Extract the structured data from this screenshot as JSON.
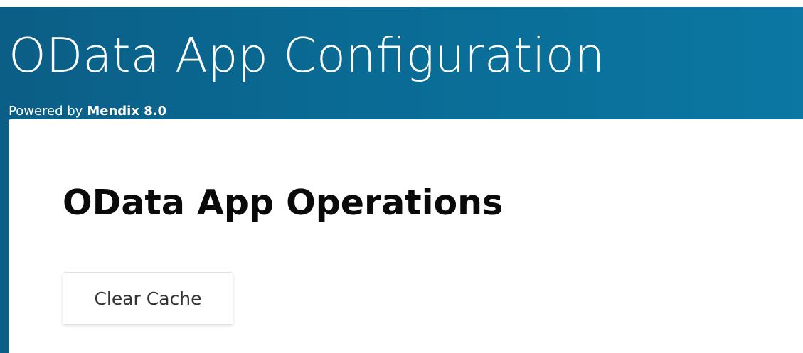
{
  "header": {
    "title": "OData App Configuration",
    "powered_by_label": "Powered by",
    "platform": "Mendix 8.0"
  },
  "main": {
    "section_title": "OData App Operations",
    "clear_cache_label": "Clear Cache"
  },
  "colors": {
    "header_background": "#0a6a93",
    "header_text": "#ffffff",
    "content_background": "#ffffff"
  }
}
